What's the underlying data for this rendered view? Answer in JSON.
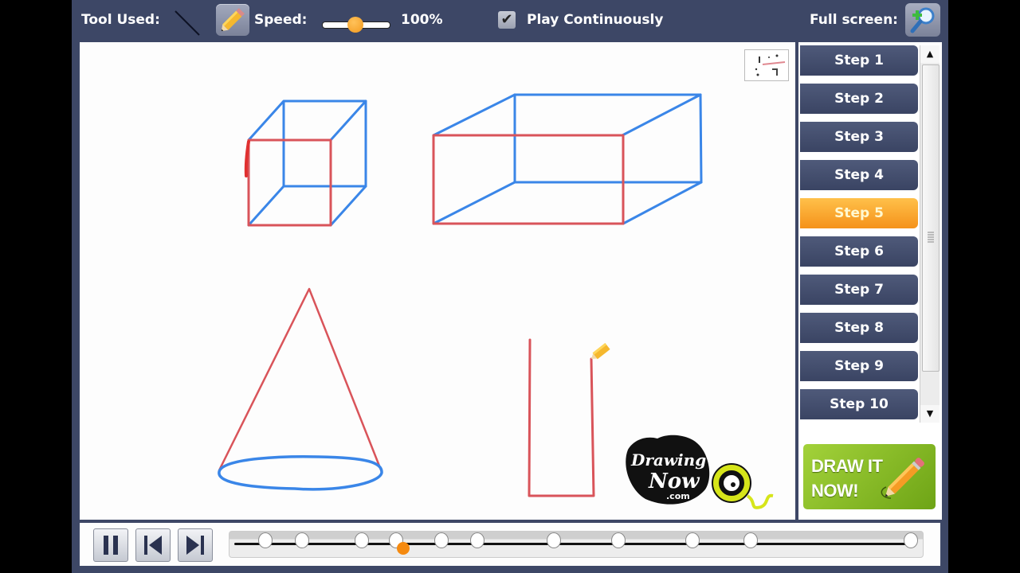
{
  "toolbar": {
    "tool_used_label": "Tool Used:",
    "speed_label": "Speed:",
    "speed_value": "100%",
    "speed_fraction": 0.5,
    "play_continuously_label": "Play Continuously",
    "play_continuously_checked": true,
    "checkmark_glyph": "✔",
    "fullscreen_label": "Full screen:"
  },
  "steps": {
    "items": [
      {
        "label": "Step 1"
      },
      {
        "label": "Step 2"
      },
      {
        "label": "Step 3"
      },
      {
        "label": "Step 4"
      },
      {
        "label": "Step 5",
        "active": true
      },
      {
        "label": "Step 6"
      },
      {
        "label": "Step 7"
      },
      {
        "label": "Step 8"
      },
      {
        "label": "Step 9"
      },
      {
        "label": "Step 10"
      }
    ],
    "active_index": 4,
    "scroll_up_glyph": "▲",
    "scroll_down_glyph": "▼"
  },
  "promo": {
    "line1": "DRAW IT",
    "line2": "NOW!"
  },
  "logo": {
    "line1": "Drawing",
    "line2": "Now",
    "line3": ".com"
  },
  "colors": {
    "frame": "#3d4766",
    "accent_orange": "#f5921a",
    "stroke_red": "#d9545a",
    "stroke_blue": "#3a86e8",
    "promo_green": "#86bb26"
  },
  "playback": {
    "state": "playing",
    "timeline_markers": 12,
    "current_position_fraction": 0.25
  }
}
